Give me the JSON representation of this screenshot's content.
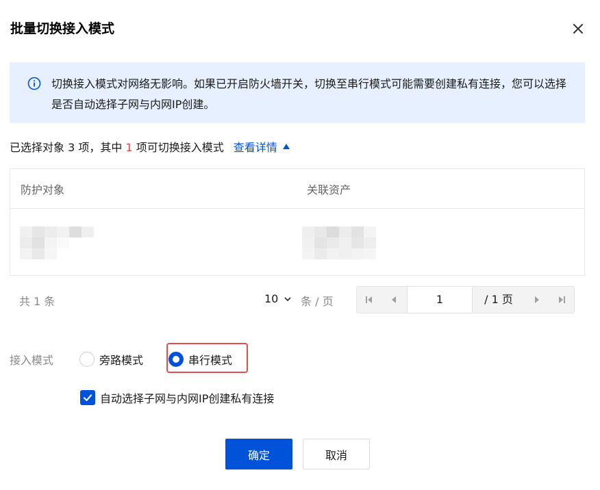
{
  "dialog": {
    "title": "批量切换接入模式",
    "close_icon": "close-icon"
  },
  "alert": {
    "icon": "info-icon",
    "text": "切换接入模式对网络无影响。如果已开启防火墙开关，切换至串行模式可能需要创建私有连接，您可以选择是否自动选择子网与内网IP创建。",
    "accent_color": "#0052d9",
    "background_color": "#e6f0ff"
  },
  "summary": {
    "prefix": "已选择对象 3 项，其中 ",
    "switchable_count": "1",
    "suffix": " 项可切换接入模式",
    "detail_link": "查看详情",
    "highlight_color": "#e54545"
  },
  "table": {
    "columns": [
      "防护对象",
      "关联资产"
    ]
  },
  "pagination": {
    "total": "共 1 条",
    "page_size": "10",
    "page_size_unit": "条 / 页",
    "current_page": "1",
    "total_pages": "/ 1 页"
  },
  "mode": {
    "label": "接入模式",
    "options": [
      "旁路模式",
      "串行模式"
    ],
    "selected": "串行模式"
  },
  "auto_option": {
    "label": "自动选择子网与内网IP创建私有连接",
    "checked": true
  },
  "footer": {
    "confirm": "确定",
    "cancel": "取消",
    "primary_color": "#0052d9"
  }
}
